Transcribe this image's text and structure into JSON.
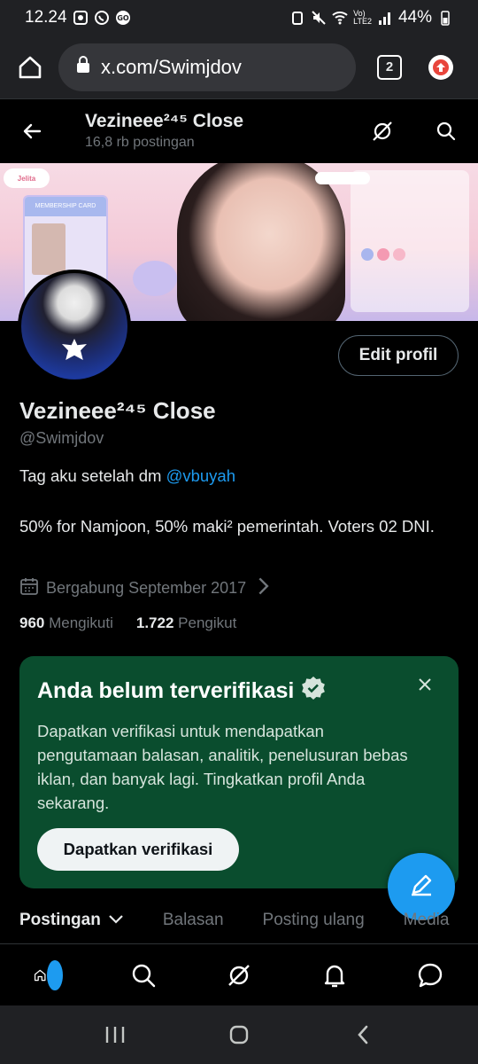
{
  "status_bar": {
    "time": "12.24",
    "volte": "Vo)\nLTE2",
    "battery": "44%"
  },
  "browser": {
    "url": "x.com/Swimjdov",
    "tab_count": "2"
  },
  "header": {
    "name": "Vezineee²⁴⁵ Close",
    "post_count": "16,8 rb postingan"
  },
  "banner": {
    "pill_text": "Jelita",
    "card_title": "MEMBERSHIP CARD"
  },
  "profile": {
    "edit_label": "Edit profil",
    "name": "Vezineee²⁴⁵ Close",
    "handle": "@Swimjdov",
    "bio_line1_prefix": "Tag aku setelah dm ",
    "bio_mention": "@vbuyah",
    "bio_line2": "50% for Namjoon, 50% maki² pemerintah. Voters 02 DNI.",
    "joined": "Bergabung September 2017",
    "following_count": "960",
    "following_label": "Mengikuti",
    "followers_count": "1.722",
    "followers_label": "Pengikut"
  },
  "verify": {
    "title": "Anda belum terverifikasi",
    "text": "Dapatkan verifikasi untuk mendapatkan pengutamaan balasan, analitik, penelusuran bebas iklan, dan banyak lagi. Tingkatkan profil Anda sekarang.",
    "button": "Dapatkan verifikasi"
  },
  "tabs": [
    "Postingan",
    "Balasan",
    "Posting ulang",
    "Media"
  ],
  "colors": {
    "accent": "#1d9bf0",
    "verify_bg": "#0a4d2e"
  },
  "icons": {
    "compose": "feather-plus-icon"
  }
}
